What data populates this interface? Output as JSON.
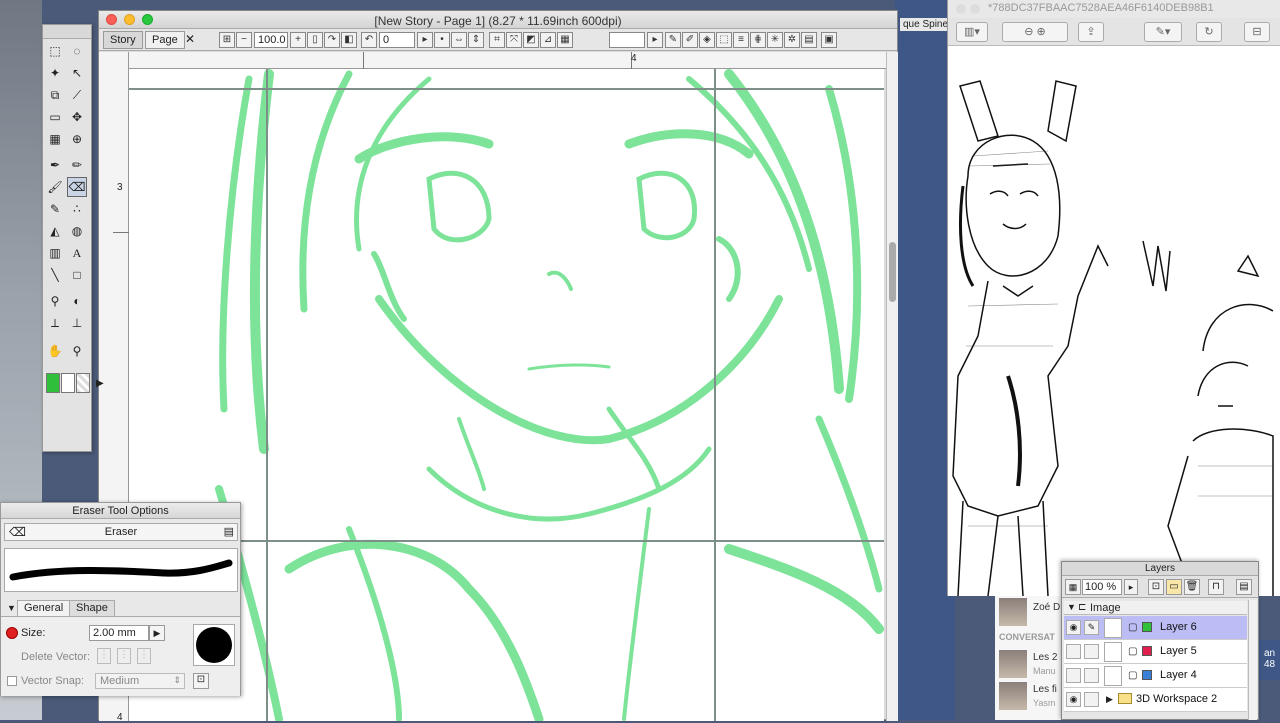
{
  "main_window": {
    "title": "[New Story - Page 1] (8.27 * 11.69inch 600dpi)",
    "tabs": [
      "Story",
      "Page"
    ],
    "zoom": "100.0",
    "rotation": "0",
    "ruler_top_mark": "4",
    "ruler_left_marks": [
      "3",
      "4"
    ]
  },
  "behind_window": {
    "title_fragment": "que Spinett"
  },
  "eraser_panel": {
    "title": "Eraser Tool Options",
    "tool_name": "Eraser",
    "tabs": [
      "General",
      "Shape"
    ],
    "size_label": "Size:",
    "size_value": "2.00 mm",
    "delete_vector_label": "Delete Vector:",
    "vector_snap_label": "Vector Snap:",
    "vector_snap_value": "Medium"
  },
  "ref_window": {
    "title": "*788DC37FBAAC7528AEA46F6140DEB98B1"
  },
  "chat": {
    "name1": "Zoé D",
    "section": "CONVERSAT",
    "item1_title": "Les 2",
    "item1_sub": "Manu",
    "item2_title": "Les fi",
    "item2_sub": "Yasm",
    "badge1": "an",
    "badge2": "48"
  },
  "layers": {
    "title": "Layers",
    "opacity": "100 %",
    "group_name": "Image",
    "rows": [
      {
        "name": "Layer 6",
        "color": "#2fbf3a",
        "selected": true
      },
      {
        "name": "Layer 5",
        "color": "#e0204a",
        "selected": false
      },
      {
        "name": "Layer 4",
        "color": "#3a7fd8",
        "selected": false
      },
      {
        "name": "3D Workspace 2",
        "color": "",
        "selected": false
      }
    ]
  },
  "colors": {
    "sketch_green": "#6fe08f",
    "selected_layer": "#bdbdf5"
  }
}
